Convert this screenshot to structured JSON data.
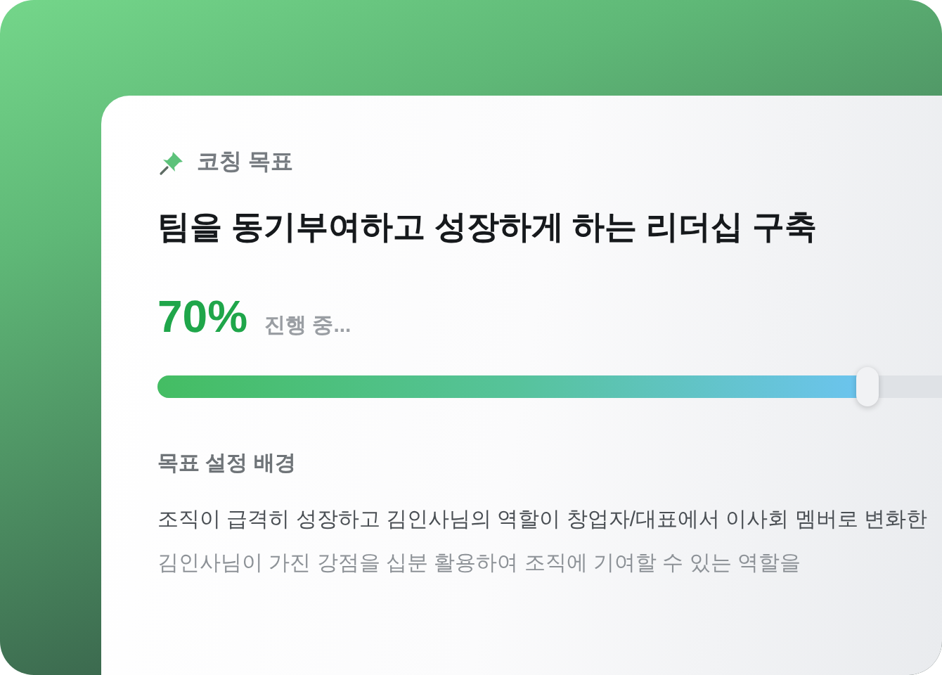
{
  "goal_card": {
    "label": "코칭 목표",
    "title": "팀을 동기부여하고 성장하게 하는 리더십 구축",
    "percent": "70%",
    "status": "진행 중...",
    "progress": {
      "level": 0.7
    }
  },
  "background_section": {
    "heading": "목표 설정 배경",
    "lines": [
      "조직이 급격히 성장하고 김인사님의 역할이 창업자/대표에서 이사회 멤버로 변화한",
      "김인사님이 가진 강점을 십분 활용하여 조직에 기여할 수 있는 역할을"
    ]
  }
}
